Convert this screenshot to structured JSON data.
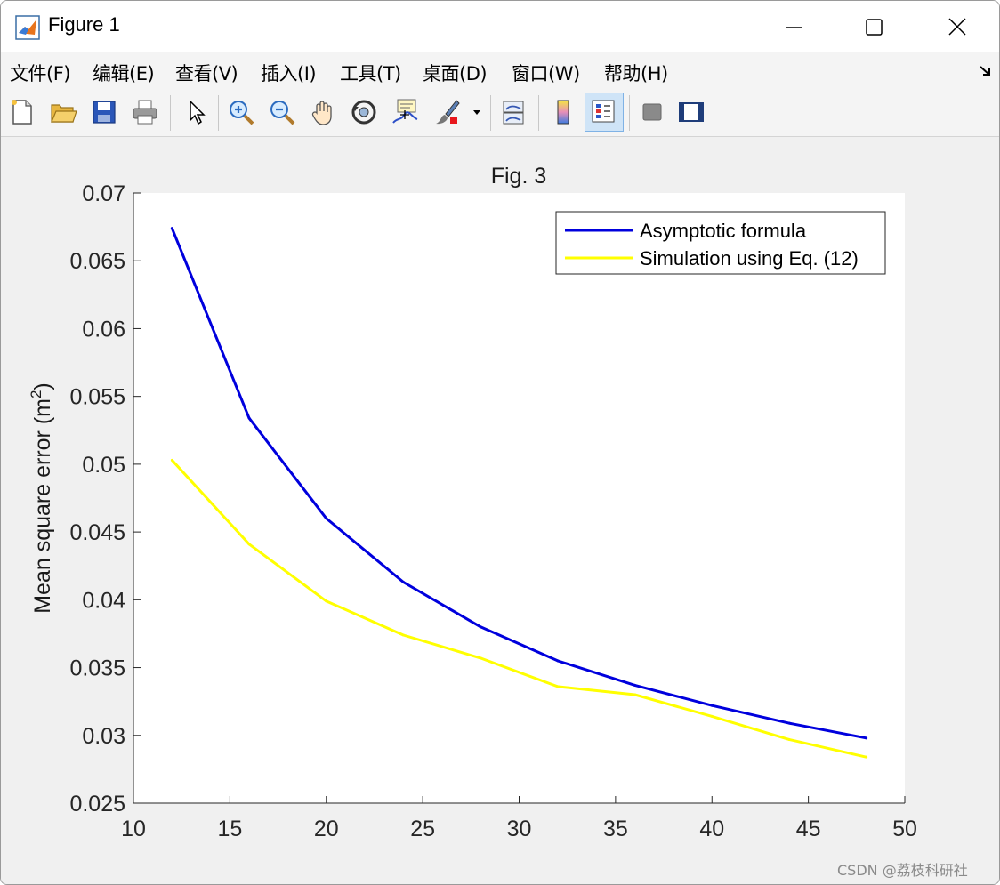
{
  "window": {
    "title": "Figure 1",
    "menu": [
      "文件(F)",
      "编辑(E)",
      "查看(V)",
      "插入(I)",
      "工具(T)",
      "桌面(D)",
      "窗口(W)",
      "帮助(H)"
    ]
  },
  "toolbar": {
    "icons": [
      "new-file-icon",
      "open-folder-icon",
      "save-icon",
      "print-icon",
      "pointer-icon",
      "zoom-in-icon",
      "zoom-out-icon",
      "pan-hand-icon",
      "rotate-3d-icon",
      "data-cursor-icon",
      "brush-icon",
      "link-plot-icon",
      "colorbar-icon",
      "legend-icon",
      "hide-tools-icon",
      "dock-figure-icon"
    ]
  },
  "watermark": "CSDN @荔枝科研社",
  "chart_data": {
    "type": "line",
    "title": "Fig. 3",
    "xlabel": "",
    "ylabel": "Mean square error (m²)",
    "ylabel_main": "Mean square error (m",
    "ylabel_sup": "2",
    "ylabel_tail": ")",
    "xlim": [
      10,
      50
    ],
    "ylim": [
      0.025,
      0.07
    ],
    "xticks": [
      "10",
      "15",
      "20",
      "25",
      "30",
      "35",
      "40",
      "45",
      "50"
    ],
    "yticks": [
      "0.025",
      "0.03",
      "0.035",
      "0.04",
      "0.045",
      "0.05",
      "0.055",
      "0.06",
      "0.065",
      "0.07"
    ],
    "grid": false,
    "legend_position": "top-right",
    "x": [
      12,
      16,
      20,
      24,
      28,
      32,
      36,
      40,
      44,
      48
    ],
    "series": [
      {
        "name": "Asymptotic formula",
        "color": "#0000dd",
        "values": [
          0.0674,
          0.0534,
          0.046,
          0.0413,
          0.038,
          0.0355,
          0.0337,
          0.0322,
          0.0309,
          0.0298
        ]
      },
      {
        "name": "Simulation using Eq. (12)",
        "color": "#ffff00",
        "values": [
          0.0503,
          0.0441,
          0.0399,
          0.0374,
          0.0357,
          0.0336,
          0.033,
          0.0314,
          0.0297,
          0.0284
        ]
      }
    ]
  }
}
